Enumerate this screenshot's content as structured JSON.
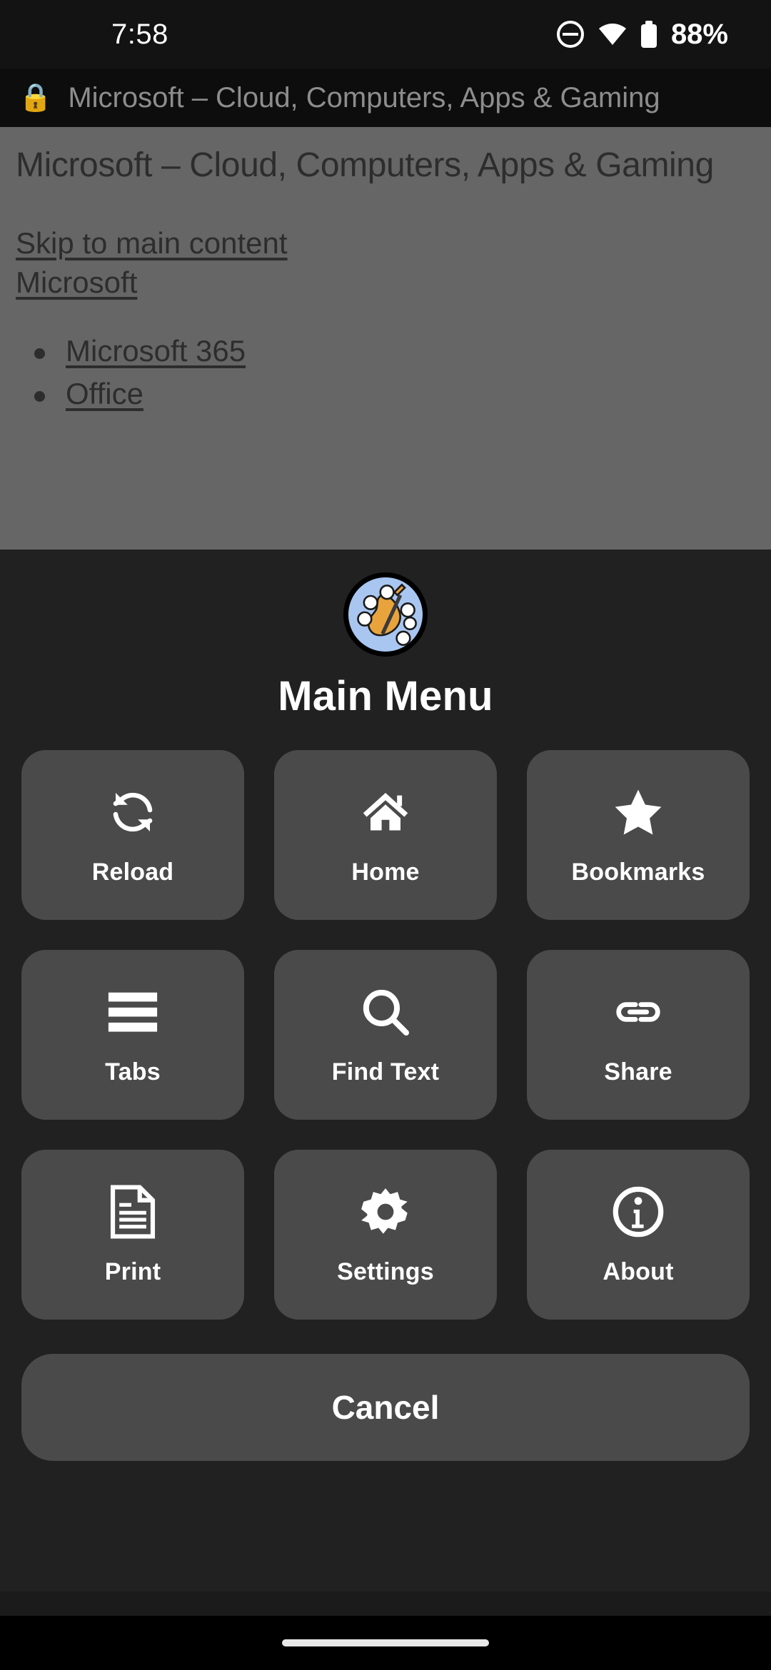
{
  "status_bar": {
    "time": "7:58",
    "battery_percent": "88%",
    "icons": [
      "do-not-disturb-icon",
      "wifi-icon",
      "battery-icon"
    ]
  },
  "browser": {
    "title_bar": {
      "lock_icon": "🔒",
      "title": "Microsoft – Cloud, Computers, Apps & Gaming"
    },
    "page": {
      "heading": "Microsoft – Cloud, Computers, Apps & Gaming",
      "links": [
        "Skip to main content",
        "Microsoft"
      ],
      "nav_items": [
        "Microsoft 365",
        "Office"
      ]
    }
  },
  "menu": {
    "logo_icon": "violin-clouds-app-icon",
    "title": "Main Menu",
    "tiles": [
      {
        "label": "Reload",
        "icon": "reload-icon"
      },
      {
        "label": "Home",
        "icon": "home-icon"
      },
      {
        "label": "Bookmarks",
        "icon": "star-icon"
      },
      {
        "label": "Tabs",
        "icon": "hamburger-icon"
      },
      {
        "label": "Find Text",
        "icon": "search-icon"
      },
      {
        "label": "Share",
        "icon": "link-icon"
      },
      {
        "label": "Print",
        "icon": "document-icon"
      },
      {
        "label": "Settings",
        "icon": "gear-icon"
      },
      {
        "label": "About",
        "icon": "info-circle-icon"
      }
    ],
    "cancel_label": "Cancel"
  },
  "colors": {
    "sheet_background": "#212121",
    "tile_background": "#4a4a4a",
    "page_dim": "#666666",
    "accent_text": "#ffffff",
    "logo_sky": "#a8c6f0",
    "logo_violin": "#e8a33d"
  }
}
